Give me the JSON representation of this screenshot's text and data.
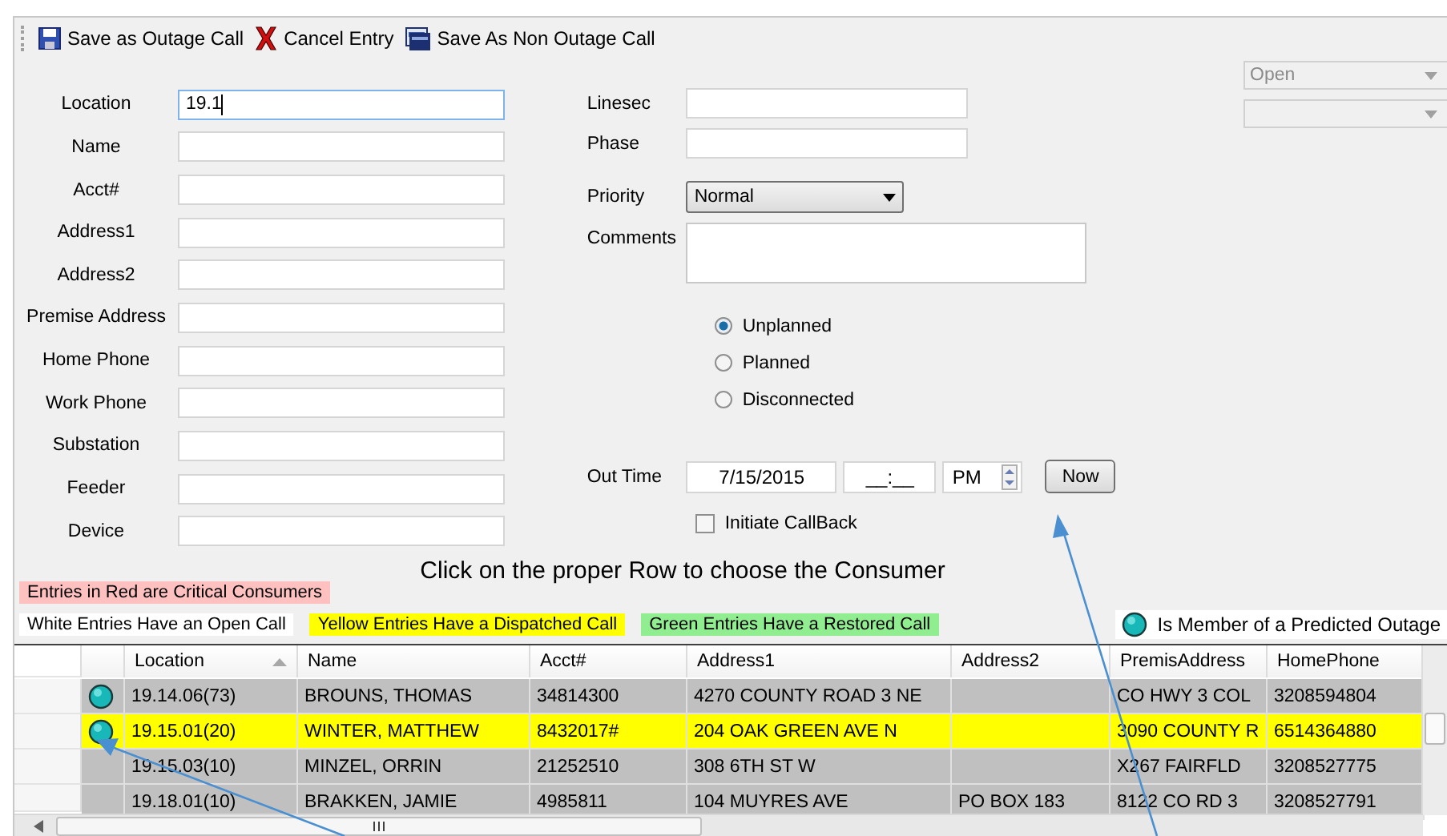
{
  "toolbar": [
    {
      "kind": "save",
      "label": "Save as Outage Call"
    },
    {
      "kind": "cancel",
      "label": "Cancel Entry"
    },
    {
      "kind": "nonoutage",
      "label": "Save As Non Outage Call"
    }
  ],
  "left_fields": [
    {
      "label": "Location",
      "value": "19.1",
      "focused": true
    },
    {
      "label": "Name",
      "focused": false
    },
    {
      "label": "Acct#",
      "focused": false
    },
    {
      "label": "Address1",
      "focused": false
    },
    {
      "label": "Address2",
      "focused": false
    },
    {
      "label": "Premise Address",
      "focused": false
    },
    {
      "label": "Home Phone",
      "focused": false
    },
    {
      "label": "Work Phone",
      "focused": false
    },
    {
      "label": "Substation",
      "focused": false
    },
    {
      "label": "Feeder",
      "focused": false
    },
    {
      "label": "Device",
      "focused": false
    }
  ],
  "mid_fields": [
    {
      "label": "Linesec"
    },
    {
      "label": "Phase"
    }
  ],
  "priority": {
    "label": "Priority",
    "value": "Normal"
  },
  "comments": {
    "label": "Comments"
  },
  "outage_types": [
    {
      "label": "Unplanned",
      "selected": true
    },
    {
      "label": "Planned",
      "selected": false
    },
    {
      "label": "Disconnected",
      "selected": false
    }
  ],
  "out_time": {
    "label": "Out Time",
    "date": "7/15/2015",
    "time": "__:__",
    "ampm": "PM",
    "now_button": "Now"
  },
  "callback": {
    "label": "Initiate CallBack",
    "checked": false
  },
  "status_dropdowns": [
    {
      "value": "Open",
      "disabled": true
    },
    {
      "disabled": true
    }
  ],
  "instruction": "Click on the proper Row  to choose the Consumer",
  "legend_top": {
    "text": "Entries in Red are Critical Consumers",
    "color": "#ffc0c0"
  },
  "legend": [
    {
      "text": "White Entries Have an Open Call",
      "color": "#ffffff"
    },
    {
      "text": "Yellow Entries Have a Dispatched Call",
      "color": "#ffff00"
    },
    {
      "text": "Green Entries Have a Restored Call",
      "color": "#90ee90"
    }
  ],
  "predicted_legend": "Is Member of a Predicted Outage",
  "grid": {
    "columns": [
      {
        "label": "Location",
        "sorted": true
      },
      {
        "label": "Name",
        "sorted": false
      },
      {
        "label": "Acct#",
        "sorted": false
      },
      {
        "label": "Address1",
        "sorted": false
      },
      {
        "label": "Address2",
        "sorted": false
      },
      {
        "label": "PremisAddress",
        "sorted": false
      },
      {
        "label": "HomePhone",
        "sorted": false
      }
    ],
    "rows": [
      {
        "color": "#c0c0c0",
        "predicted": true,
        "location": "19.14.06(73)",
        "name": "BROUNS, THOMAS",
        "acct": "34814300",
        "address1": "4270 COUNTY ROAD 3 NE",
        "premis": "CO HWY 3 COL",
        "phone": "3208594804"
      },
      {
        "color": "#ffff00",
        "predicted": true,
        "location": "19.15.01(20)",
        "name": "WINTER, MATTHEW",
        "acct": "8432017#",
        "address1": "204 OAK GREEN AVE N",
        "premis": "3090 COUNTY R",
        "phone": "6514364880"
      },
      {
        "color": "#c0c0c0",
        "predicted": false,
        "location": "19.15.03(10)",
        "name": "MINZEL, ORRIN",
        "acct": "21252510",
        "address1": "308 6TH ST W",
        "premis": "X267 FAIRFLD",
        "phone": "3208527775"
      },
      {
        "color": "#c0c0c0",
        "predicted": false,
        "location": "19.18.01(10)",
        "name": "BRAKKEN, JAMIE",
        "acct": "4985811",
        "address1": "104 MUYRES AVE",
        "address2": "PO BOX 183",
        "premis": "8122 CO RD 3",
        "phone": "3208527791"
      }
    ]
  }
}
